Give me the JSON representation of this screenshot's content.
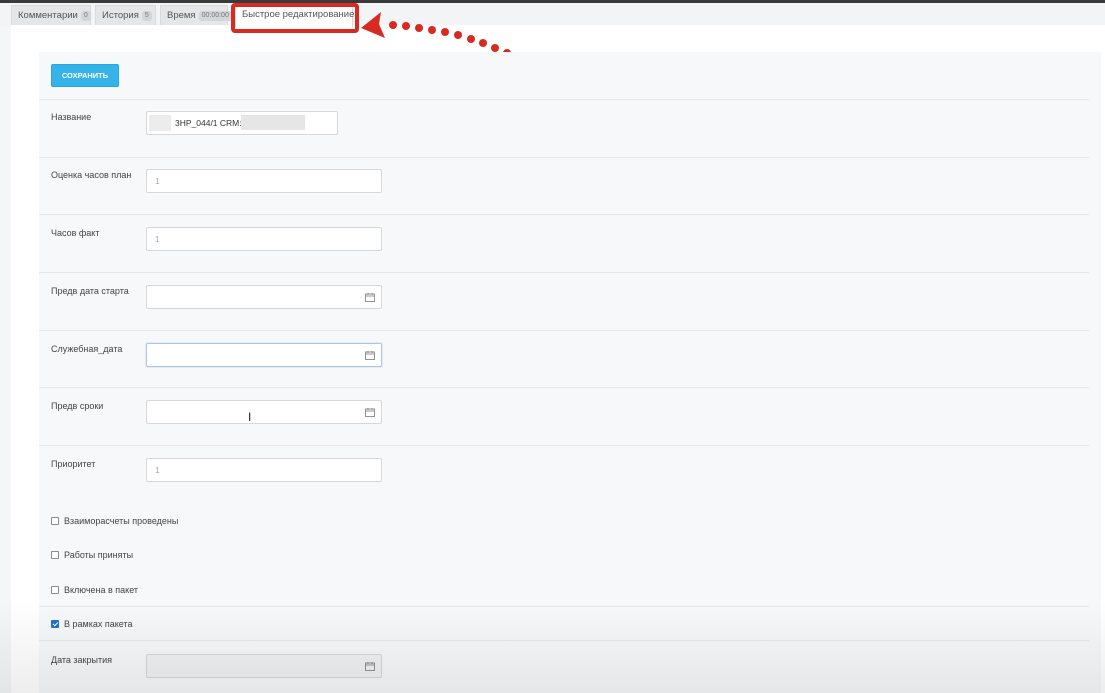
{
  "tabs": [
    {
      "label": "Комментарии",
      "badge": "0"
    },
    {
      "label": "История",
      "badge": "5"
    },
    {
      "label": "Время",
      "badge": "00:00:00"
    },
    {
      "label": "Быстрое редактирование",
      "badge": null
    }
  ],
  "active_tab": "Быстрое редактирование",
  "toolbar": {
    "save_label": "СОХРАНИТЬ"
  },
  "form": {
    "name": {
      "label": "Название",
      "value": "3HP_044/1 CRM:"
    },
    "estimate": {
      "label": "Оценка часов план",
      "placeholder": "1"
    },
    "actual": {
      "label": "Часов факт",
      "placeholder": "1"
    },
    "pre_start": {
      "label": "Предв дата старта",
      "value": ""
    },
    "service_date": {
      "label": "Служебная_дата",
      "value": ""
    },
    "pre_terms": {
      "label": "Предв сроки",
      "value": ""
    },
    "priority": {
      "label": "Приоритет",
      "placeholder": "1"
    },
    "checks": [
      {
        "label": "Взаиморасчеты проведены",
        "checked": false
      },
      {
        "label": "Работы приняты",
        "checked": false
      },
      {
        "label": "Включена в пакет",
        "checked": false
      },
      {
        "label": "В рамках пакета",
        "checked": true
      }
    ],
    "close_date": {
      "label": "Дата закрытия",
      "value": ""
    }
  },
  "colors": {
    "accent": "#35b4ea",
    "annotation": "#d72b22",
    "checkbox_checked": "#1f73c9"
  },
  "icons": [
    "calendar-icon",
    "text-cursor-icon",
    "annotation-arrow"
  ]
}
